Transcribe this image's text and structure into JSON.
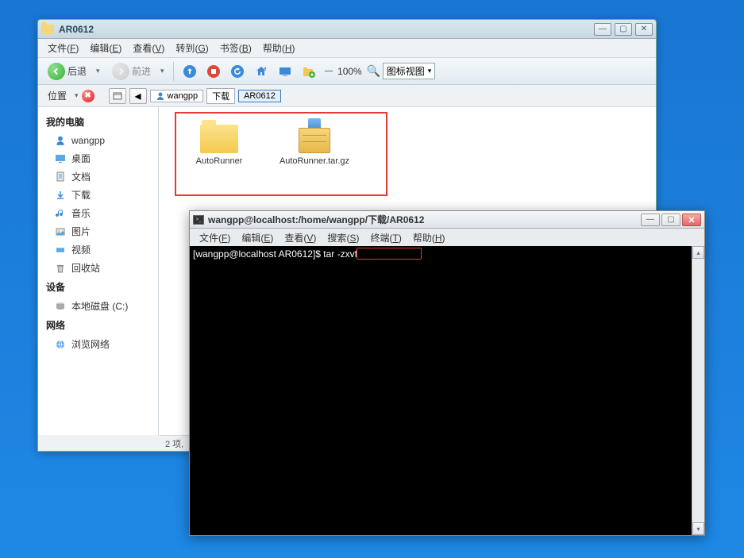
{
  "fm": {
    "title": "AR0612",
    "menus": [
      {
        "label": "文件",
        "key": "F"
      },
      {
        "label": "编辑",
        "key": "E"
      },
      {
        "label": "查看",
        "key": "V"
      },
      {
        "label": "转到",
        "key": "G"
      },
      {
        "label": "书签",
        "key": "B"
      },
      {
        "label": "帮助",
        "key": "H"
      }
    ],
    "back": "后退",
    "forward": "前进",
    "zoom": "100%",
    "view_mode": "图标视图",
    "location_label": "位置",
    "breadcrumbs": [
      {
        "label": "wangpp",
        "icon": "user"
      },
      {
        "label": "下载",
        "icon": ""
      },
      {
        "label": "AR0612",
        "icon": "",
        "active": true
      }
    ],
    "sidebar": {
      "s1": "我的电脑",
      "items1": [
        {
          "label": "wangpp",
          "icon": "user"
        },
        {
          "label": "桌面",
          "icon": "desktop"
        },
        {
          "label": "文档",
          "icon": "docs"
        },
        {
          "label": "下载",
          "icon": "download"
        },
        {
          "label": "音乐",
          "icon": "music"
        },
        {
          "label": "图片",
          "icon": "pictures"
        },
        {
          "label": "视频",
          "icon": "video"
        },
        {
          "label": "回收站",
          "icon": "trash"
        }
      ],
      "s2": "设备",
      "items2": [
        {
          "label": "本地磁盘 (C:)",
          "icon": "disk"
        }
      ],
      "s3": "网络",
      "items3": [
        {
          "label": "浏览网络",
          "icon": "network"
        }
      ]
    },
    "files": [
      {
        "name": "AutoRunner",
        "type": "folder"
      },
      {
        "name": "AutoRunner.tar.gz",
        "type": "archive"
      }
    ],
    "status": "2 项,"
  },
  "term": {
    "title": "wangpp@localhost:/home/wangpp/下载/AR0612",
    "menus": [
      {
        "label": "文件",
        "key": "F"
      },
      {
        "label": "编辑",
        "key": "E"
      },
      {
        "label": "查看",
        "key": "V"
      },
      {
        "label": "搜索",
        "key": "S"
      },
      {
        "label": "终端",
        "key": "T"
      },
      {
        "label": "帮助",
        "key": "H"
      }
    ],
    "prompt": "[wangpp@localhost AR0612]$ ",
    "command": "tar -zxvf "
  }
}
